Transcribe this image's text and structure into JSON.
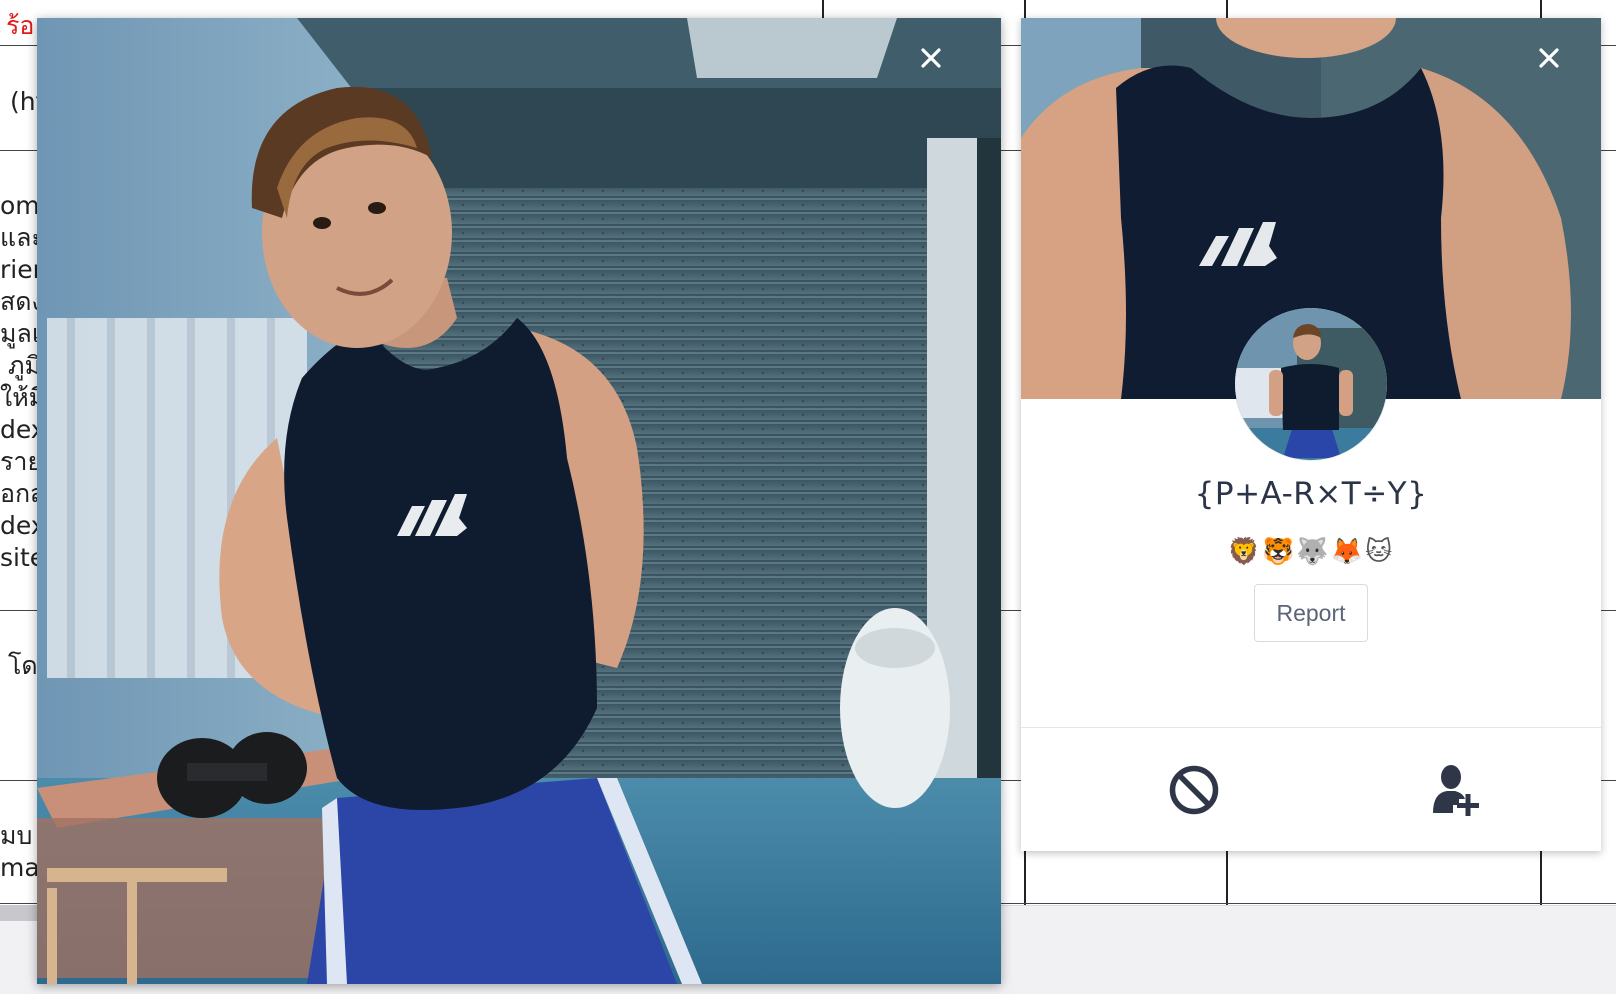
{
  "background_page": {
    "top_text": "ร้อ",
    "row_texts": [
      "(ht",
      "ome",
      "และ",
      "rien",
      "สดง",
      "มูลแ",
      "ภูมิ",
      "ให้มี",
      "dex",
      "ราย",
      "อกส",
      "dex",
      "site",
      "โด",
      "มบ ท",
      "ma"
    ]
  },
  "photo_viewer": {
    "close_icon": "close-icon"
  },
  "profile": {
    "display_name": "{P+A-R×T÷Y}",
    "emojis": "🦁🐯🐺🦊🐱",
    "report_label": "Report",
    "block_icon": "block-icon",
    "add_friend_icon": "add-friend-icon",
    "close_icon": "close-icon"
  },
  "colors": {
    "name_text": "#2c3547",
    "icon": "#2f3648",
    "report_text": "#5b6478"
  }
}
